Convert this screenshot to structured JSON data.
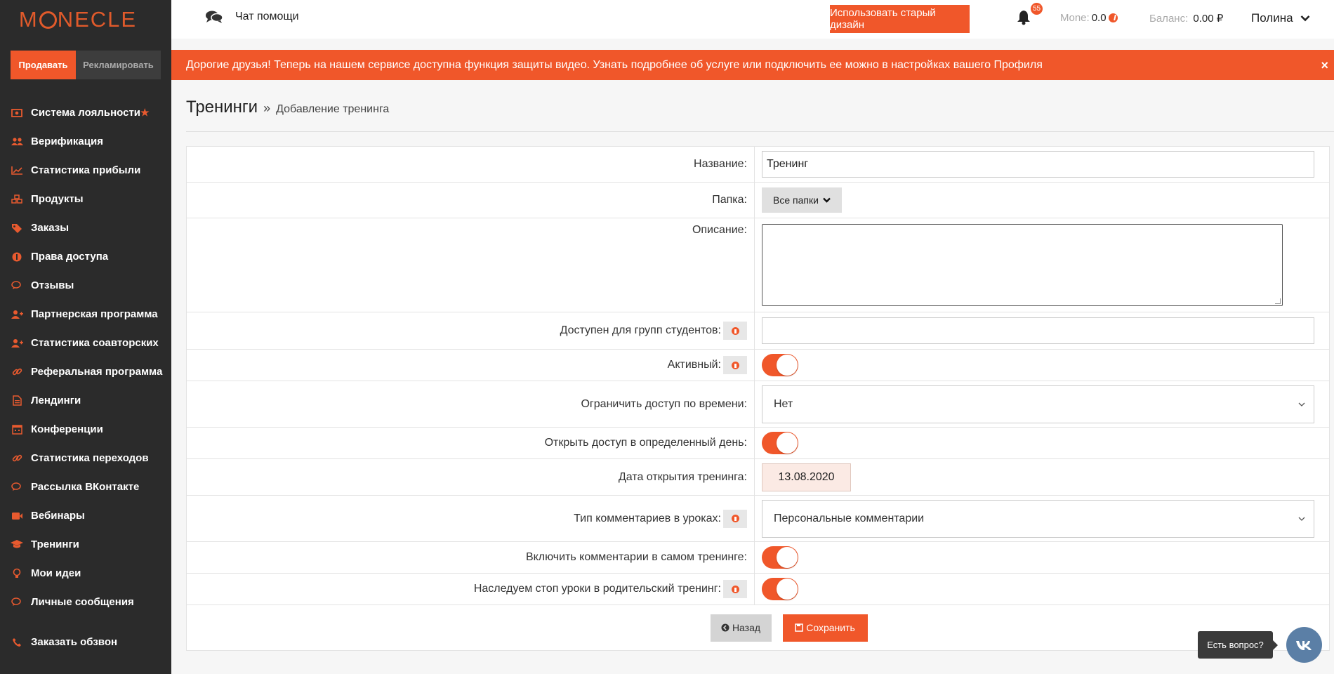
{
  "brand": {
    "logo_pre": "M",
    "logo_post": "NECLE"
  },
  "sidebar": {
    "modes": [
      {
        "label": "Продавать"
      },
      {
        "label": "Рекламировать"
      }
    ],
    "items": [
      {
        "label": "Система лояльности",
        "icon": "money-icon"
      },
      {
        "label": "Верификация",
        "icon": "users-icon"
      },
      {
        "label": "Статистика прибыли",
        "icon": "line-chart-icon"
      },
      {
        "label": "Продукты",
        "icon": "cubes-icon"
      },
      {
        "label": "Заказы",
        "icon": "tags-icon"
      },
      {
        "label": "Права доступа",
        "icon": "shield-icon"
      },
      {
        "label": "Отзывы",
        "icon": "comments-icon"
      },
      {
        "label": "Партнерская программа",
        "icon": "user-plus-icon"
      },
      {
        "label": "Статистика соавторских",
        "icon": "user-plus-icon"
      },
      {
        "label": "Реферальная программа",
        "icon": "link-icon"
      },
      {
        "label": "Лендинги",
        "icon": "file-icon"
      },
      {
        "label": "Конференции",
        "icon": "calendar-icon"
      },
      {
        "label": "Статистика переходов",
        "icon": "link-icon"
      },
      {
        "label": "Рассылка ВКонтакте",
        "icon": "comments-icon"
      },
      {
        "label": "Вебинары",
        "icon": "video-icon"
      },
      {
        "label": "Тренинги",
        "icon": "graduation-cap-icon"
      },
      {
        "label": "Мои идеи",
        "icon": "lightbulb-icon"
      },
      {
        "label": "Личные сообщения",
        "icon": "comments-icon"
      }
    ],
    "bottom_item": {
      "label": "Заказать обзвон",
      "icon": "phone-icon"
    }
  },
  "header": {
    "chat_label": "Чат помощи",
    "old_design_label": "Использовать старый дизайн",
    "notifications_count": "55",
    "mone_label": "Mone:",
    "mone_value": "0.0",
    "balance_label": "Баланс:",
    "balance_value": "0.00 ₽",
    "user_name": "Полина"
  },
  "alert": {
    "text": "Дорогие друзья! Теперь на нашем сервисе доступна функция защиты видео. Узнать подробнее об услуге или подключить ее можно в настройках вашего Профиля",
    "close": "×"
  },
  "page": {
    "title": "Тренинги",
    "separator": "»",
    "crumb": "Добавление тренинга"
  },
  "form": {
    "name_label": "Название:",
    "name_value": "Тренинг",
    "folder_label": "Папка:",
    "folder_value": "Все папки",
    "description_label": "Описание:",
    "groups_label": "Доступен для групп студентов:",
    "active_label": "Активный:",
    "time_limit_label": "Ограничить доступ по времени:",
    "time_limit_value": "Нет",
    "open_day_label": "Открыть доступ в определенный день:",
    "open_date_label": "Дата открытия тренинга:",
    "open_date_value": "13.08.2020",
    "comment_type_label": "Тип комментариев в уроках:",
    "comment_type_value": "Персональные комментарии",
    "enable_comments_label": "Включить комментарии в самом тренинге:",
    "inherit_stop_label": "Наследуем стоп уроки в родительский тренинг:",
    "toggles": {
      "active": true,
      "open_day": true,
      "enable_comments": true,
      "inherit_stop": true
    },
    "back_label": "Назад",
    "save_label": "Сохранить"
  },
  "widget": {
    "question_label": "Есть вопрос?",
    "vk_label": "vk"
  },
  "colors": {
    "accent": "#f0572a",
    "sidebar": "#2b2b2b",
    "vk": "#5b7fa6"
  }
}
